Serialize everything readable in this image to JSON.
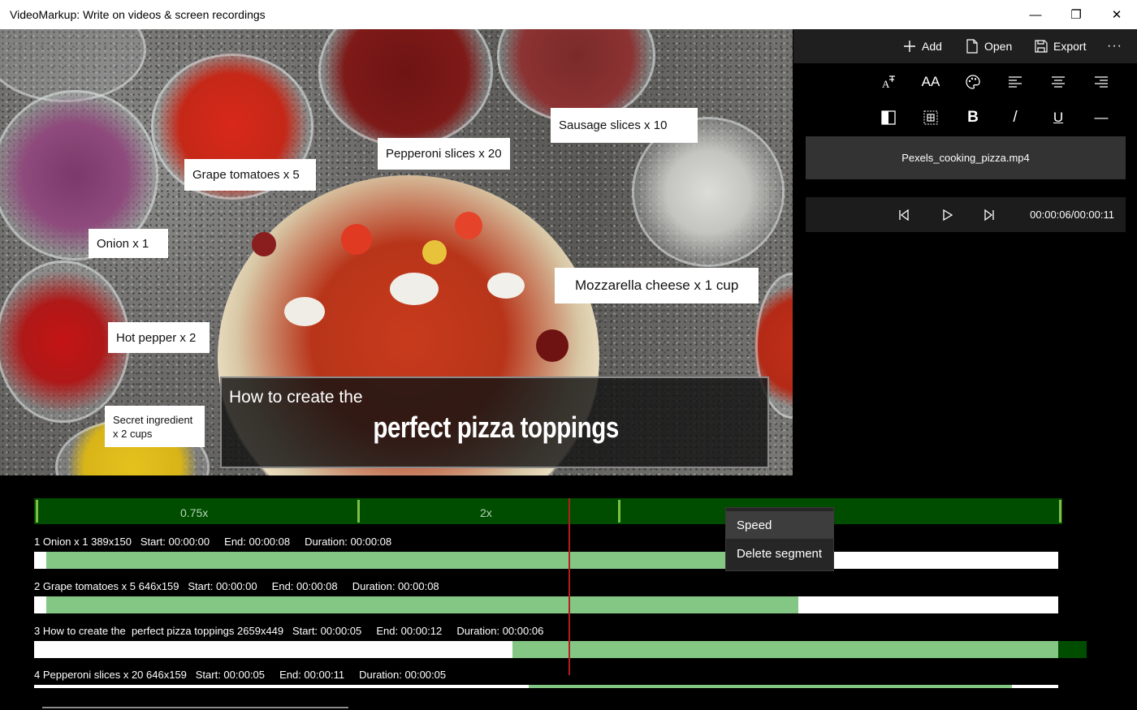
{
  "window": {
    "title": "VideoMarkup: Write on videos & screen recordings",
    "minimize": "—",
    "restore": "❐",
    "close": "✕"
  },
  "toolbar": {
    "add": "Add",
    "open": "Open",
    "export": "Export",
    "more": "···"
  },
  "format": {
    "font_size": "AA",
    "bold": "B",
    "italic": "/",
    "underline": "U",
    "strike": "—"
  },
  "file": {
    "name": "Pexels_cooking_pizza.mp4"
  },
  "player": {
    "timecode": "00:00:06/00:00:11"
  },
  "video": {
    "callouts": [
      "Sausage slices x 10",
      "Pepperoni slices x 20",
      "Grape tomatoes x 5",
      "Onion x 1",
      "Mozzarella cheese x 1 cup",
      "Hot pepper x 2",
      "Secret ingredient x 2 cups"
    ],
    "title_line1": "How to create the",
    "title_line2": "perfect pizza toppings"
  },
  "timeline": {
    "speed_labels": [
      "0.75x",
      "2x"
    ],
    "tracks": [
      {
        "info": "1 Onion x 1 389x150   Start: 00:00:00     End: 00:00:08     Duration: 00:00:08"
      },
      {
        "info": "2 Grape tomatoes x 5 646x159   Start: 00:00:00     End: 00:00:08     Duration: 00:00:08"
      },
      {
        "info": "3 How to create the  perfect pizza toppings 2659x449   Start: 00:00:05     End: 00:00:12     Duration: 00:00:06"
      },
      {
        "info": "4 Pepperoni slices x 20 646x159   Start: 00:00:05     End: 00:00:11     Duration: 00:00:05"
      }
    ]
  },
  "context_menu": {
    "items": [
      "Speed",
      "Delete segment"
    ]
  },
  "colors": {
    "segment": "#84c784",
    "speed_band": "#004d00",
    "playhead": "#b71c1c"
  }
}
